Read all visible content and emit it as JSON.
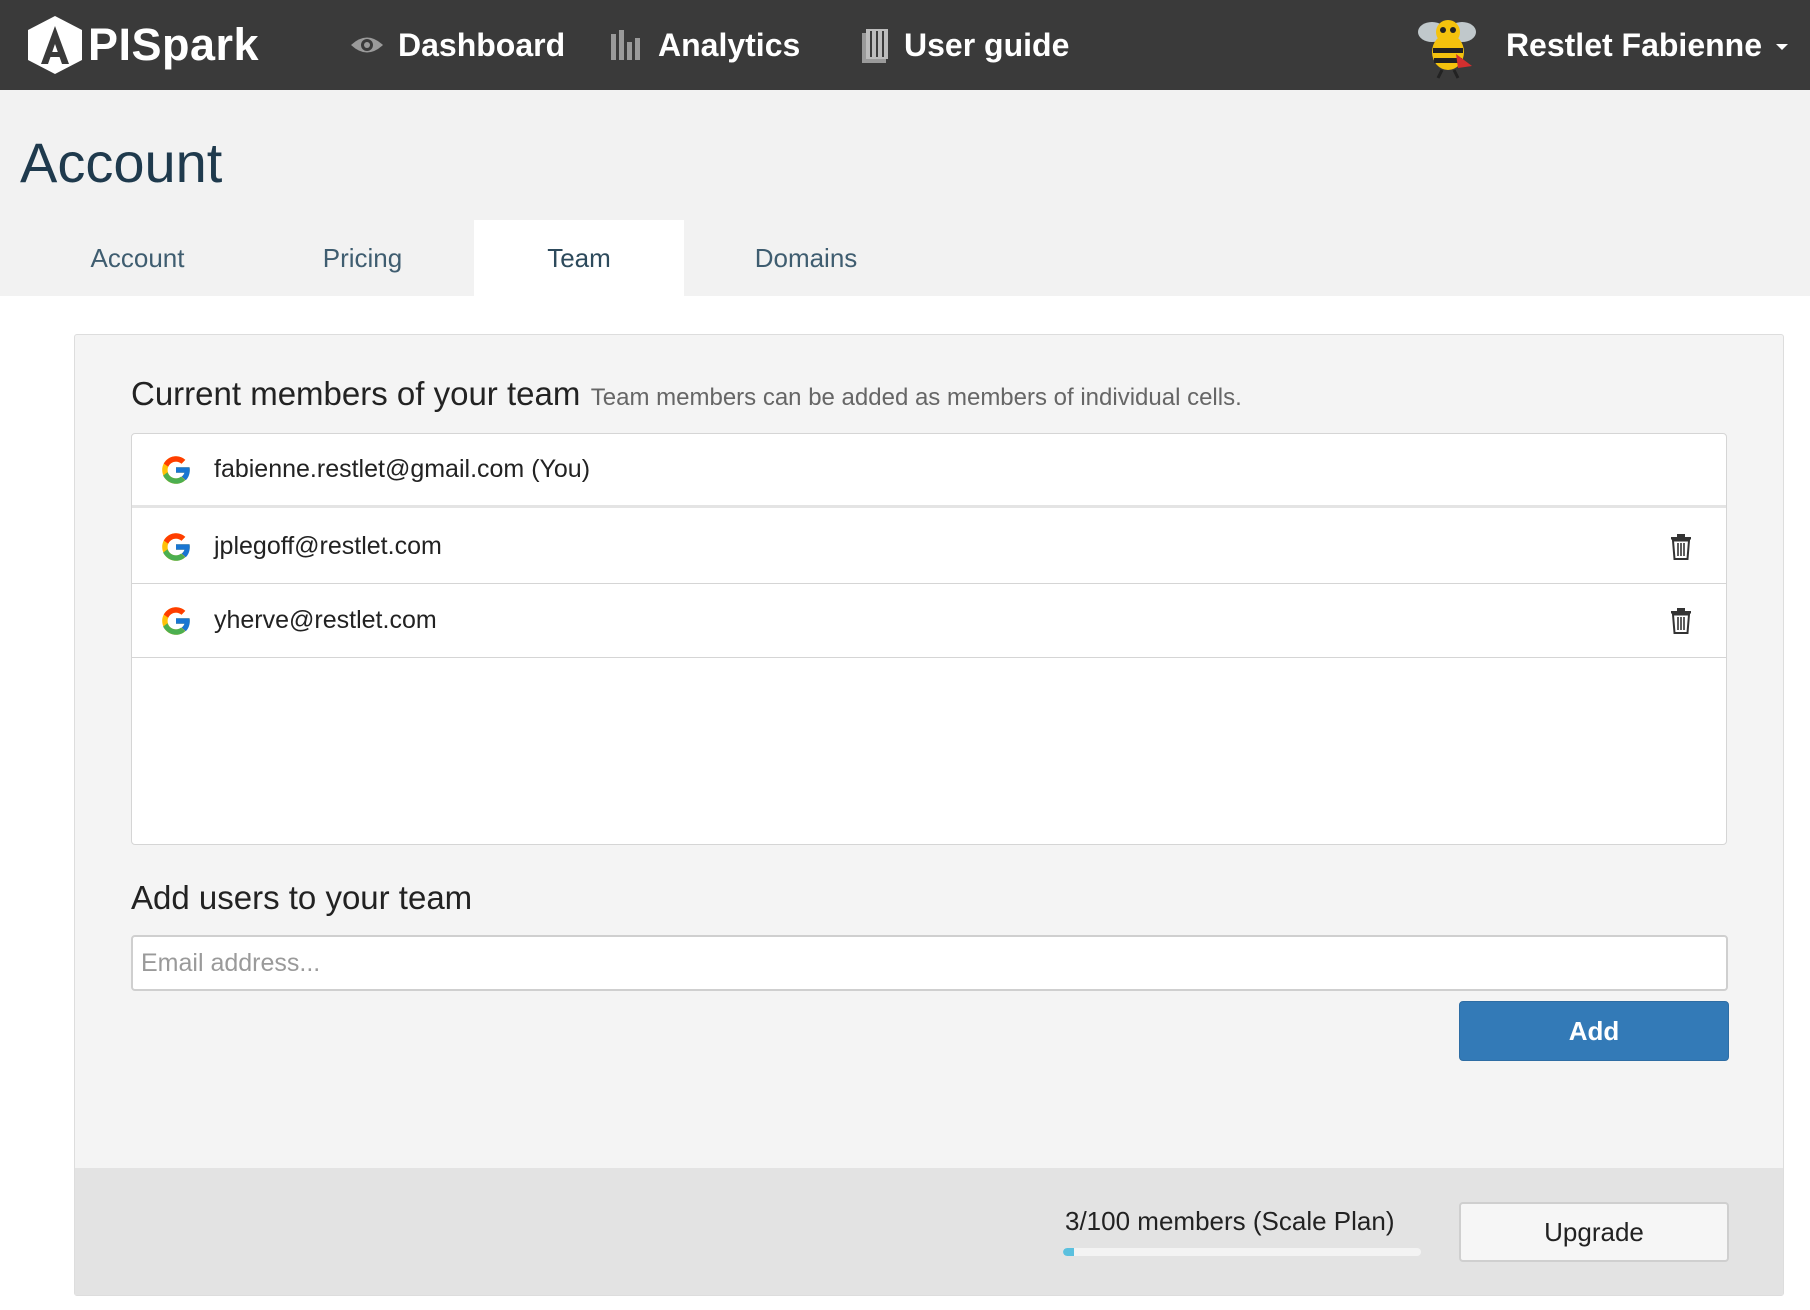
{
  "navbar": {
    "logo_text": "PISpark",
    "items": [
      {
        "label": "Dashboard",
        "icon": "eye-icon"
      },
      {
        "label": "Analytics",
        "icon": "bar-chart-icon"
      },
      {
        "label": "User guide",
        "icon": "book-icon"
      }
    ],
    "user": {
      "name": "Restlet Fabienne",
      "avatar": "bee-avatar"
    }
  },
  "page": {
    "title": "Account"
  },
  "tabs": [
    {
      "label": "Account",
      "active": false
    },
    {
      "label": "Pricing",
      "active": false
    },
    {
      "label": "Team",
      "active": true
    },
    {
      "label": "Domains",
      "active": false
    }
  ],
  "team": {
    "heading": "Current members of your team",
    "subheading": "Team members can be added as members of individual cells.",
    "members": [
      {
        "email": "fabienne.restlet@gmail.com (You)",
        "provider": "google-icon",
        "removable": false
      },
      {
        "email": "jplegoff@restlet.com",
        "provider": "google-icon",
        "removable": true
      },
      {
        "email": "yherve@restlet.com",
        "provider": "google-icon",
        "removable": true
      }
    ]
  },
  "add_users": {
    "heading": "Add users to your team",
    "input_placeholder": "Email address...",
    "input_value": "",
    "button_label": "Add"
  },
  "footer": {
    "members_text": "3/100 members (Scale Plan)",
    "members_used": 3,
    "members_max": 100,
    "upgrade_label": "Upgrade"
  },
  "colors": {
    "navbar_bg": "#3a3a3a",
    "primary_button": "#337ab7",
    "progress_fill": "#5bc0de",
    "title_color": "#1f3a4d"
  }
}
